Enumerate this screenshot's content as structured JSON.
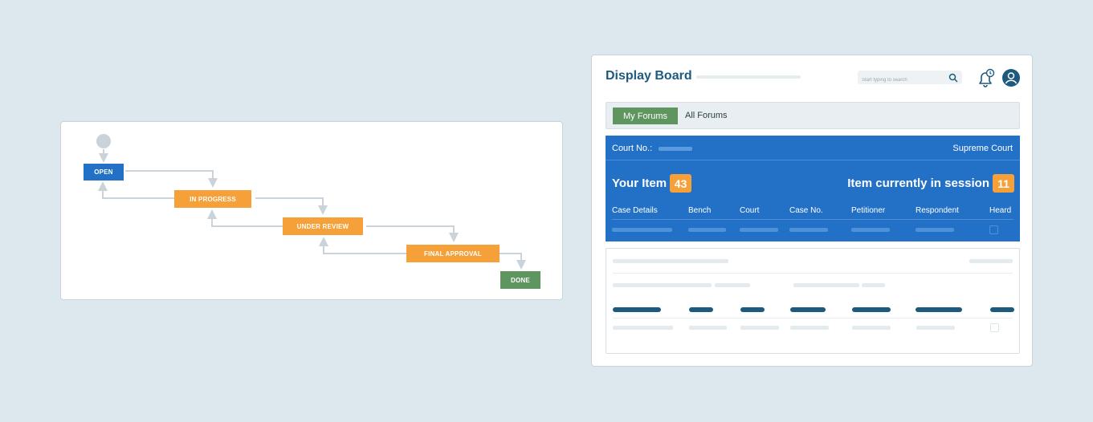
{
  "workflow": {
    "nodes": [
      {
        "id": "open",
        "label": "OPEN",
        "color": "#2371c6"
      },
      {
        "id": "in_progress",
        "label": "IN PROGRESS",
        "color": "#f6a03a"
      },
      {
        "id": "under_review",
        "label": "UNDER REVIEW",
        "color": "#f6a03a"
      },
      {
        "id": "final_approval",
        "label": "FINAL APPROVAL",
        "color": "#f6a03a"
      },
      {
        "id": "done",
        "label": "DONE",
        "color": "#5f9660"
      }
    ]
  },
  "board": {
    "title": "Display Board",
    "search": {
      "placeholder": "Start typing to search"
    },
    "tabs": {
      "active": "My Forums",
      "inactive": "All Forums"
    },
    "panel": {
      "court_no_label": "Court No.:",
      "court_name": "Supreme Court",
      "your_item_label": "Your Item",
      "your_item_value": "43",
      "session_label": "Item currently in session",
      "session_value": "11",
      "columns": [
        "Case Details",
        "Bench",
        "Court",
        "Case No.",
        "Petitioner",
        "Respondent",
        "Heard"
      ]
    },
    "colors": {
      "primary": "#2371c6",
      "accent": "#f6a03a",
      "success": "#5f9660",
      "heading": "#1d5a7e"
    }
  }
}
